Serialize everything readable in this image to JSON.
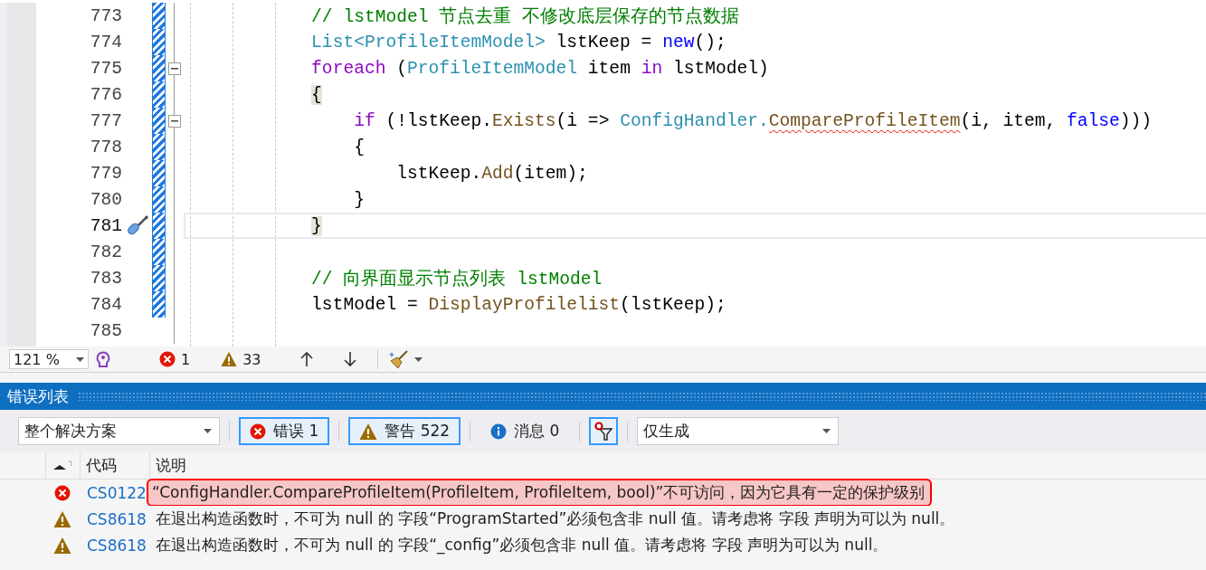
{
  "editor": {
    "lines": [
      {
        "number": "773",
        "modified": true,
        "foldable": false,
        "current": false,
        "quick_action": false,
        "tokens": [
          {
            "kind": "comment",
            "text": "            // lstModel 节点去重 不修改底层保存的节点数据"
          }
        ]
      },
      {
        "number": "774",
        "modified": true,
        "foldable": false,
        "current": false,
        "quick_action": false,
        "tokens": [
          {
            "kind": "type",
            "text": "            List<ProfileItemModel>"
          },
          {
            "kind": "plain",
            "text": " lstKeep = "
          },
          {
            "kind": "keyword",
            "text": "new"
          },
          {
            "kind": "plain",
            "text": "();"
          }
        ]
      },
      {
        "number": "775",
        "modified": true,
        "foldable": true,
        "current": false,
        "quick_action": false,
        "tokens": [
          {
            "kind": "control",
            "text": "            foreach"
          },
          {
            "kind": "plain",
            "text": " ("
          },
          {
            "kind": "type",
            "text": "ProfileItemModel"
          },
          {
            "kind": "plain",
            "text": " item "
          },
          {
            "kind": "control",
            "text": "in"
          },
          {
            "kind": "plain",
            "text": " lstModel)"
          }
        ]
      },
      {
        "number": "776",
        "modified": true,
        "foldable": false,
        "current": false,
        "quick_action": false,
        "tokens": [
          {
            "kind": "brace-match",
            "text": "            {"
          }
        ]
      },
      {
        "number": "777",
        "modified": true,
        "foldable": true,
        "current": false,
        "quick_action": false,
        "tokens": [
          {
            "kind": "control",
            "text": "                if"
          },
          {
            "kind": "plain",
            "text": " (!lstKeep."
          },
          {
            "kind": "method",
            "text": "Exists"
          },
          {
            "kind": "plain",
            "text": "(i => "
          },
          {
            "kind": "type",
            "text": "ConfigHandler."
          },
          {
            "kind": "error",
            "text": "CompareProfileItem"
          },
          {
            "kind": "plain",
            "text": "(i, item, "
          },
          {
            "kind": "keyword",
            "text": "false"
          },
          {
            "kind": "plain",
            "text": ")))"
          }
        ]
      },
      {
        "number": "778",
        "modified": true,
        "foldable": false,
        "current": false,
        "quick_action": false,
        "tokens": [
          {
            "kind": "plain",
            "text": "                {"
          }
        ]
      },
      {
        "number": "779",
        "modified": true,
        "foldable": false,
        "current": false,
        "quick_action": false,
        "tokens": [
          {
            "kind": "plain",
            "text": "                    lstKeep."
          },
          {
            "kind": "method",
            "text": "Add"
          },
          {
            "kind": "plain",
            "text": "(item);"
          }
        ]
      },
      {
        "number": "780",
        "modified": true,
        "foldable": false,
        "current": false,
        "quick_action": false,
        "tokens": [
          {
            "kind": "plain",
            "text": "                }"
          }
        ]
      },
      {
        "number": "781",
        "modified": true,
        "foldable": false,
        "current": true,
        "quick_action": true,
        "tokens": [
          {
            "kind": "brace-match",
            "text": "            }"
          }
        ]
      },
      {
        "number": "782",
        "modified": true,
        "foldable": false,
        "current": false,
        "quick_action": false
      },
      {
        "number": "783",
        "modified": true,
        "foldable": false,
        "current": false,
        "quick_action": false,
        "tokens": [
          {
            "kind": "comment",
            "text": "            // 向界面显示节点列表 lstModel"
          }
        ]
      },
      {
        "number": "784",
        "modified": true,
        "foldable": false,
        "current": false,
        "quick_action": false,
        "tokens": [
          {
            "kind": "plain",
            "text": "            lstModel = "
          },
          {
            "kind": "method",
            "text": "DisplayProfilelist"
          },
          {
            "kind": "plain",
            "text": "(lstKeep);"
          }
        ]
      },
      {
        "number": "785",
        "modified": false,
        "foldable": false,
        "current": false,
        "quick_action": false
      }
    ]
  },
  "editor_toolbar": {
    "zoom": "121 %",
    "errors": "1",
    "warnings": "33"
  },
  "error_list": {
    "title": "错误列表",
    "scope": "整个解决方案",
    "filters": [
      {
        "kind": "error",
        "label": "错误 1",
        "selected": true
      },
      {
        "kind": "warning",
        "label": "警告 522",
        "selected": true
      },
      {
        "kind": "info",
        "label": "消息 0",
        "selected": false
      }
    ],
    "filter_toggle": {
      "selected": true
    },
    "source": "仅生成",
    "columns": [
      "代码",
      "说明"
    ],
    "rows": [
      {
        "kind": "error",
        "code": "CS0122",
        "description": "“ConfigHandler.CompareProfileItem(ProfileItem, ProfileItem, bool)”不可访问，因为它具有一定的保护级别",
        "highlighted": true
      },
      {
        "kind": "warning",
        "code": "CS8618",
        "description": "在退出构造函数时，不可为 null 的 字段“ProgramStarted”必须包含非 null 值。请考虑将 字段 声明为可以为 null。",
        "highlighted": false
      },
      {
        "kind": "warning",
        "code": "CS8618",
        "description": "在退出构造函数时，不可为 null 的 字段“_config”必须包含非 null 值。请考虑将 字段 声明为可以为 null。",
        "highlighted": false
      }
    ]
  }
}
